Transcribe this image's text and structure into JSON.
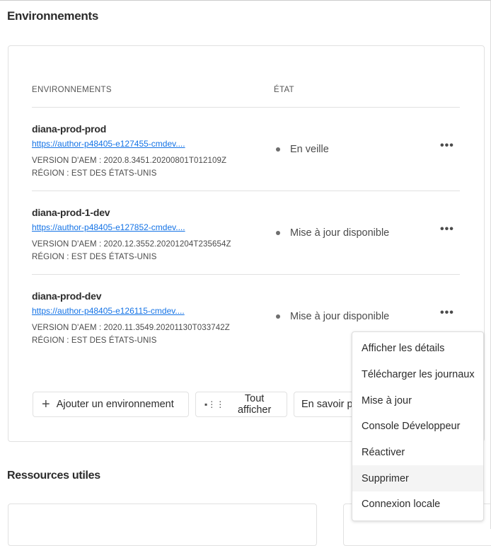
{
  "page_title": "Environnements",
  "table": {
    "col_env": "ENVIRONNEMENTS",
    "col_state": "ÉTAT"
  },
  "environments": [
    {
      "name": "diana-prod-prod",
      "url": "https://author-p48405-e127455-cmdev....",
      "version": "VERSION D'AEM  : 2020.8.3451.20200801T012109Z",
      "region": "RÉGION : EST DES ÉTATS-UNIS",
      "state": "En veille"
    },
    {
      "name": "diana-prod-1-dev",
      "url": "https://author-p48405-e127852-cmdev....",
      "version": "VERSION D'AEM  : 2020.12.3552.20201204T235654Z",
      "region": "RÉGION : EST DES ÉTATS-UNIS",
      "state": "Mise à jour disponible"
    },
    {
      "name": "diana-prod-dev",
      "url": "https://author-p48405-e126115-cmdev....",
      "version": "VERSION D'AEM  : 2020.11.3549.20201130T033742Z",
      "region": "RÉGION : EST DES ÉTATS-UNIS",
      "state": "Mise à jour disponible"
    }
  ],
  "more_glyph": "•••",
  "buttons": {
    "add": "Ajouter un environnement",
    "show_all": "Tout afficher",
    "learn_more": "En savoir p"
  },
  "resources_title": "Ressources utiles",
  "menu": [
    "Afficher les détails",
    "Télécharger les journaux",
    "Mise à jour",
    "Console Développeur",
    "Réactiver",
    "Supprimer",
    "Connexion locale"
  ],
  "menu_hovered": "Supprimer"
}
